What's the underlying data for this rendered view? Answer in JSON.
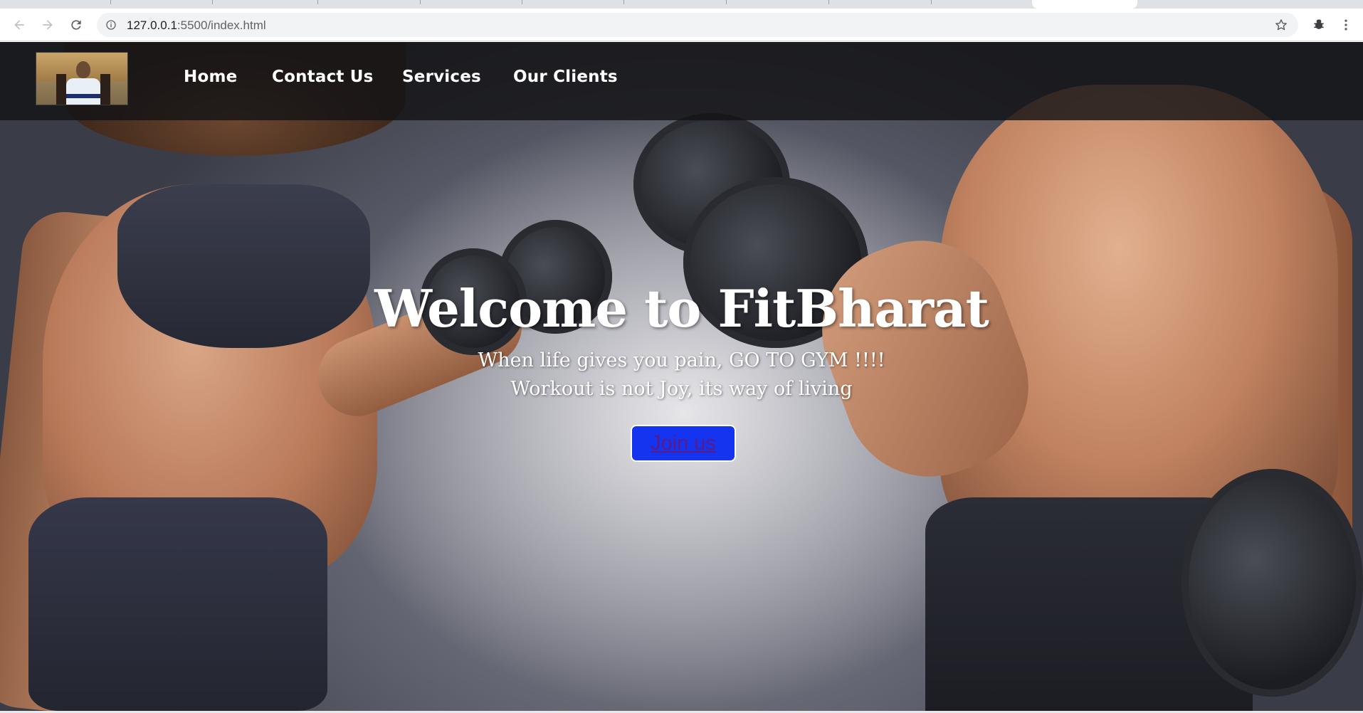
{
  "browser": {
    "url_host": "127.0.0.1",
    "url_path": ":5500/index.html",
    "icons": {
      "back": "arrow-left-icon",
      "forward": "arrow-right-icon",
      "reload": "reload-icon",
      "site_info": "info-icon",
      "bookmark": "star-icon",
      "extension": "extension-icon",
      "menu": "kebab-menu-icon"
    }
  },
  "site": {
    "logo": "profile-photo",
    "nav": {
      "home": "Home",
      "contact": "Contact Us",
      "services": "Services",
      "clients": "Our Clients"
    },
    "hero": {
      "title": "Welcome to FitBharat",
      "subtitle_1": "When life gives you pain, GO TO GYM !!!!",
      "subtitle_2": "Workout is not Joy, its way of living",
      "cta": "Join us"
    },
    "colors": {
      "navbar": "#141416",
      "cta_background": "#1434ef",
      "cta_text": "#5a1a8a",
      "text": "#ffffff"
    }
  }
}
